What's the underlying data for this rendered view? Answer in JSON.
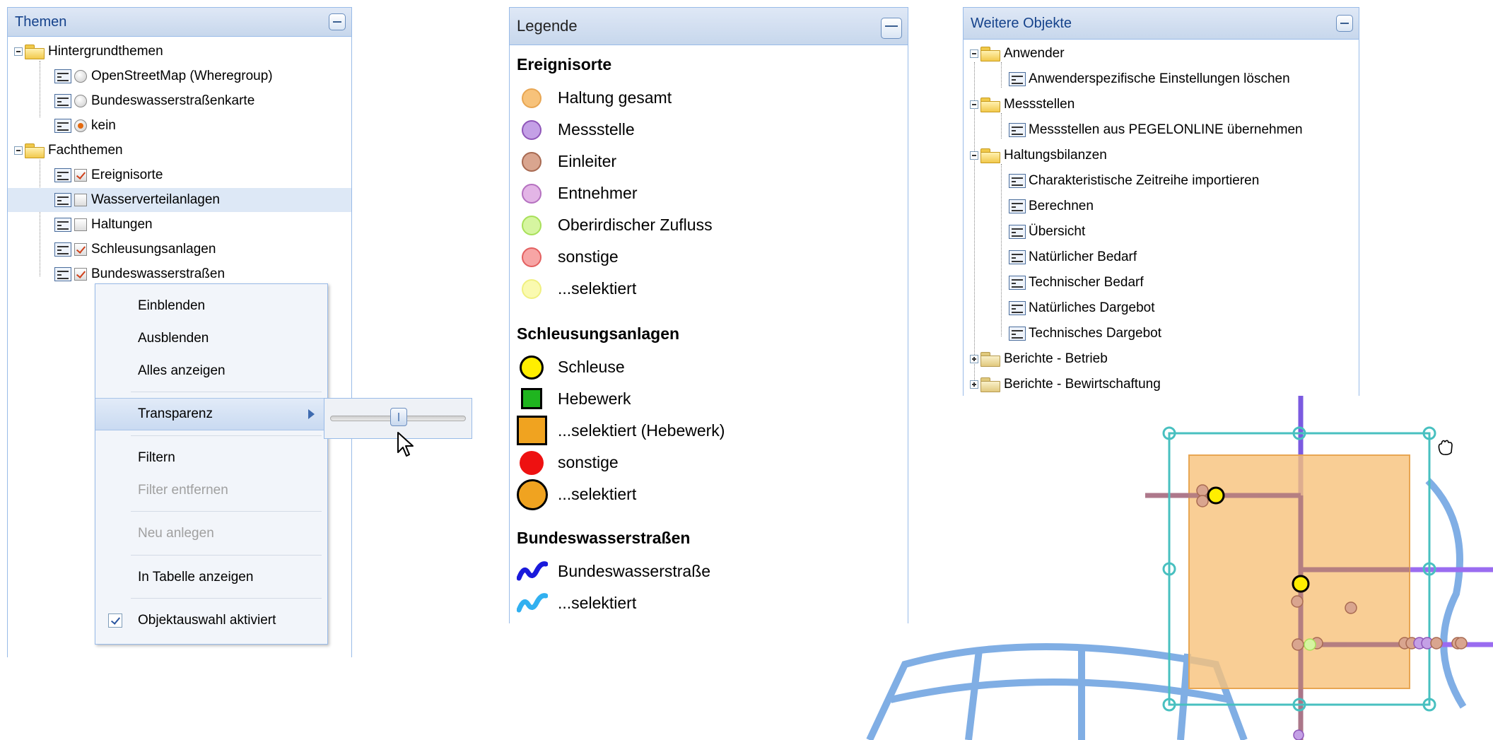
{
  "themen": {
    "title": "Themen",
    "items": [
      {
        "label": "Hintergrundthemen"
      },
      {
        "label": "OpenStreetMap (Wheregroup)"
      },
      {
        "label": "Bundeswasserstraßenkarte"
      },
      {
        "label": "kein"
      },
      {
        "label": "Fachthemen"
      },
      {
        "label": "Ereignisorte"
      },
      {
        "label": "Wasserverteilanlagen"
      },
      {
        "label": "Haltungen"
      },
      {
        "label": "Schleusungsanlagen"
      },
      {
        "label": "Bundeswasserstraßen"
      }
    ]
  },
  "context_menu": {
    "items": [
      {
        "label": "Einblenden"
      },
      {
        "label": "Ausblenden"
      },
      {
        "label": "Alles anzeigen"
      },
      {
        "label": "Transparenz"
      },
      {
        "label": "Filtern"
      },
      {
        "label": "Filter entfernen"
      },
      {
        "label": "Neu anlegen"
      },
      {
        "label": "In Tabelle anzeigen"
      },
      {
        "label": "Objektauswahl aktiviert"
      }
    ],
    "transparency_value": 0.5
  },
  "legende": {
    "title": "Legende",
    "sections": [
      {
        "title": "Ereignisorte",
        "items": [
          {
            "label": "Haltung gesamt",
            "color": "#f7c27a"
          },
          {
            "label": "Messstelle",
            "color": "#b07fd6"
          },
          {
            "label": "Einleiter",
            "color": "#c98c73"
          },
          {
            "label": "Entnehmer",
            "color": "#d59bd6"
          },
          {
            "label": "Oberirdischer Zufluss",
            "color": "#c6f27a"
          },
          {
            "label": "sonstige",
            "color": "#f28b8b"
          },
          {
            "label": "...selektiert",
            "color": "#f5f58a"
          }
        ]
      },
      {
        "title": "Schleusungsanlagen",
        "items": [
          {
            "label": "Schleuse",
            "color": "#ffee00"
          },
          {
            "label": "Hebewerk",
            "color": "#1fb51f"
          },
          {
            "label": "...selektiert (Hebewerk)",
            "color": "#f0a320"
          },
          {
            "label": "sonstige",
            "color": "#ee1111"
          },
          {
            "label": "...selektiert",
            "color": "#f0a320"
          }
        ]
      },
      {
        "title": "Bundeswasserstraßen",
        "items": [
          {
            "label": "Bundeswasserstraße",
            "color": "#1a1adb"
          },
          {
            "label": "...selektiert",
            "color": "#31b0f0"
          }
        ]
      }
    ]
  },
  "weitere": {
    "title": "Weitere Objekte",
    "items": [
      {
        "label": "Anwender"
      },
      {
        "label": "Anwenderspezifische Einstellungen löschen"
      },
      {
        "label": "Messstellen"
      },
      {
        "label": "Messstellen aus PEGELONLINE übernehmen"
      },
      {
        "label": "Haltungsbilanzen"
      },
      {
        "label": "Charakteristische Zeitreihe importieren"
      },
      {
        "label": "Berechnen"
      },
      {
        "label": "Übersicht"
      },
      {
        "label": "Natürlicher Bedarf"
      },
      {
        "label": "Technischer Bedarf"
      },
      {
        "label": "Natürliches Dargebot"
      },
      {
        "label": "Technisches Dargebot"
      },
      {
        "label": "Berichte - Betrieb"
      },
      {
        "label": "Berichte - Bewirtschaftung"
      }
    ]
  },
  "icons": [
    "collapse-icon",
    "folder-icon",
    "layer-icon",
    "radio-icon",
    "checkbox-icon",
    "submenu-arrow-icon",
    "mouse-cursor-icon",
    "hand-cursor-icon"
  ]
}
